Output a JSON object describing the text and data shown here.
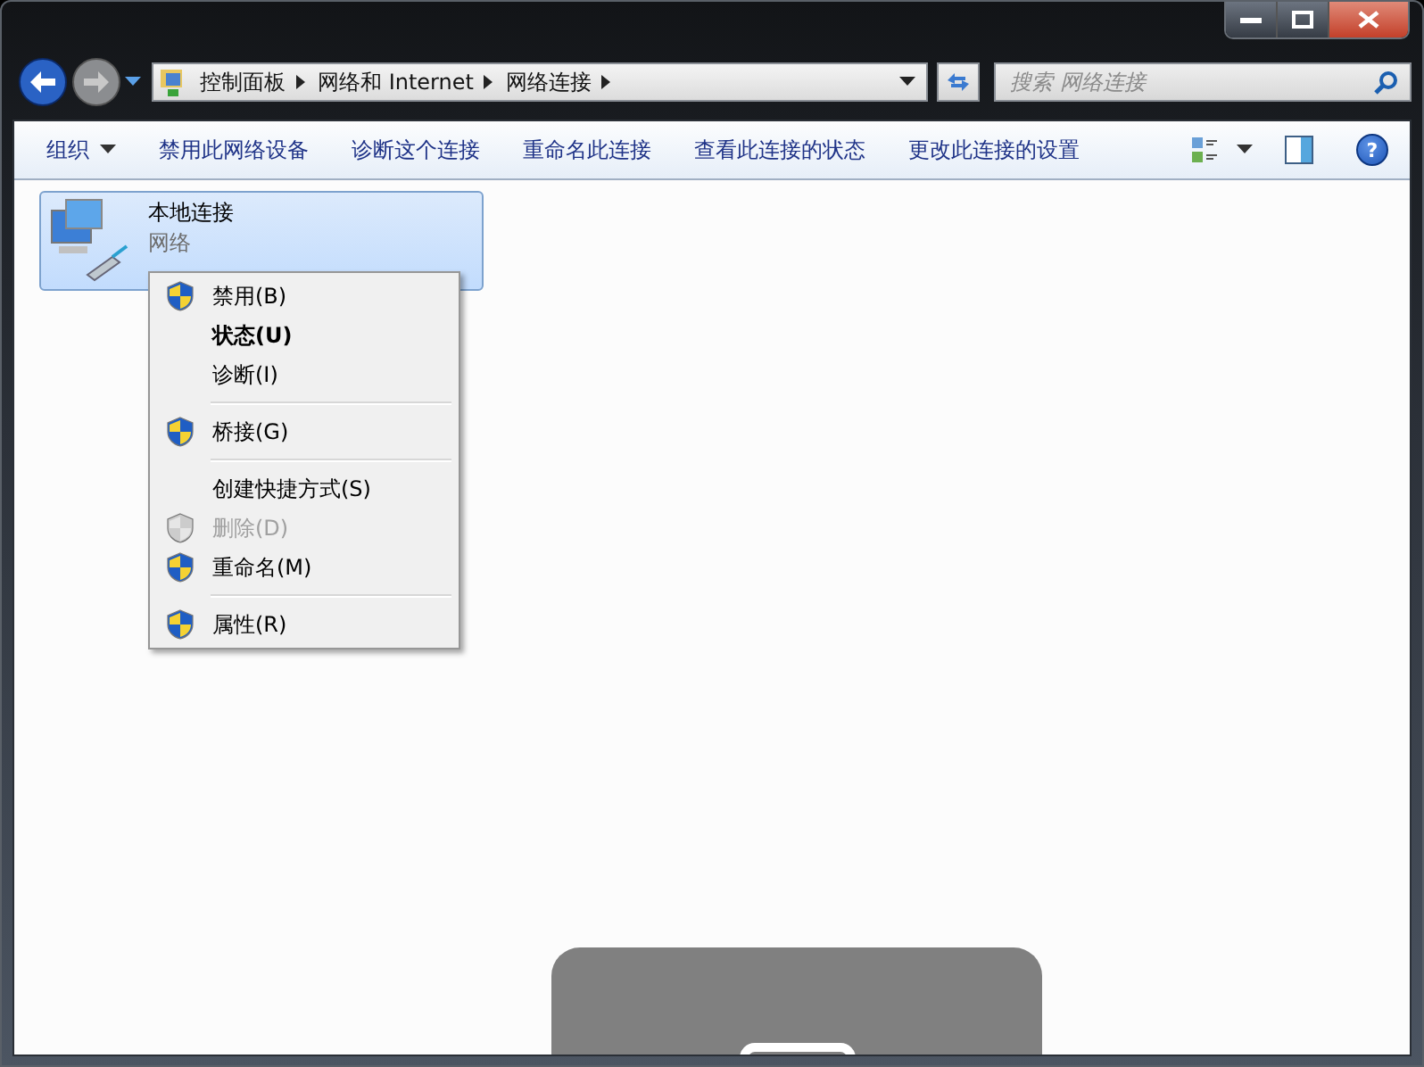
{
  "breadcrumb": [
    "控制面板",
    "网络和 Internet",
    "网络连接"
  ],
  "search": {
    "placeholder": "搜索 网络连接"
  },
  "toolbar": [
    {
      "label": "组织",
      "dropdown": true
    },
    {
      "label": "禁用此网络设备",
      "dropdown": false
    },
    {
      "label": "诊断这个连接",
      "dropdown": false
    },
    {
      "label": "重命名此连接",
      "dropdown": false
    },
    {
      "label": "查看此连接的状态",
      "dropdown": false
    },
    {
      "label": "更改此连接的设置",
      "dropdown": false
    }
  ],
  "help": "?",
  "connection": {
    "name": "本地连接",
    "status": "网络",
    "selected": true
  },
  "context_menu": [
    {
      "kind": "item",
      "label": "禁用(B)",
      "shield": true,
      "disabled": false,
      "default": false
    },
    {
      "kind": "item",
      "label": "状态(U)",
      "shield": false,
      "disabled": false,
      "default": true
    },
    {
      "kind": "item",
      "label": "诊断(I)",
      "shield": false,
      "disabled": false,
      "default": false
    },
    {
      "kind": "separator"
    },
    {
      "kind": "item",
      "label": "桥接(G)",
      "shield": true,
      "disabled": false,
      "default": false
    },
    {
      "kind": "separator"
    },
    {
      "kind": "item",
      "label": "创建快捷方式(S)",
      "shield": false,
      "disabled": false,
      "default": false
    },
    {
      "kind": "item",
      "label": "删除(D)",
      "shield": true,
      "disabled": true,
      "default": false
    },
    {
      "kind": "item",
      "label": "重命名(M)",
      "shield": true,
      "disabled": false,
      "default": false
    },
    {
      "kind": "separator"
    },
    {
      "kind": "item",
      "label": "属性(R)",
      "shield": true,
      "disabled": false,
      "default": false
    }
  ]
}
